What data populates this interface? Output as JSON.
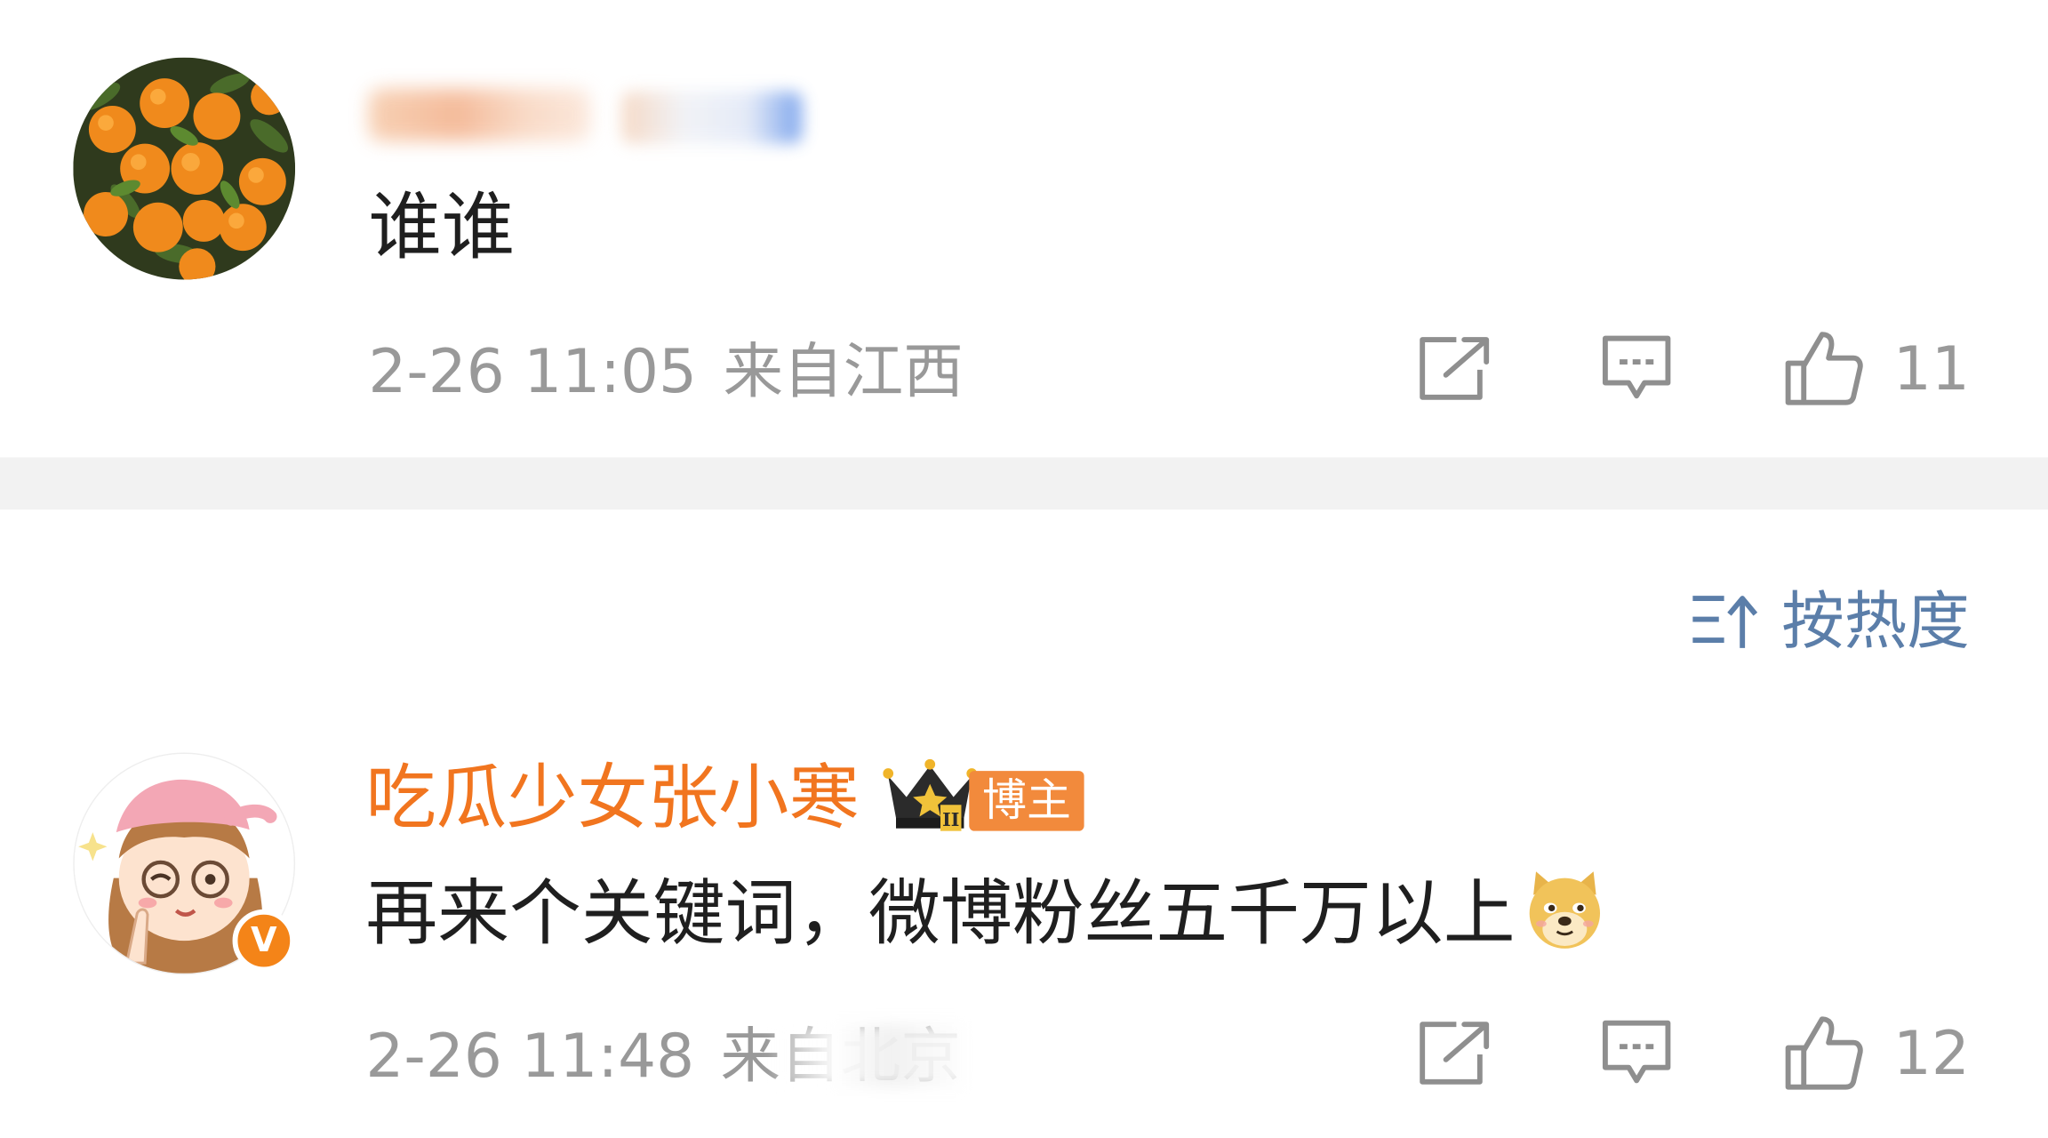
{
  "comments": [
    {
      "author": "",
      "text": "谁谁",
      "time": "2-26 11:05",
      "location": "来自江西",
      "likes": "11",
      "avatar_icon": "orange-fruit-avatar"
    },
    {
      "author": "吃瓜少女张小寒",
      "badge": "博主",
      "text": "再来个关键词，微博粉丝五千万以上",
      "emoji_icon": "doge-emoji",
      "time": "2-26 11:48",
      "location": "来自北京",
      "likes": "12",
      "verified": "V",
      "avatar_icon": "cartoon-girl-avatar"
    }
  ],
  "sort": {
    "label": "按热度",
    "icon": "sort-icon"
  },
  "colors": {
    "author_name": "#f1751f",
    "badge_bg": "#f28a3c",
    "sort_text": "#5b7ea9",
    "meta_text": "#999999",
    "divider": "#f2f2f2"
  }
}
